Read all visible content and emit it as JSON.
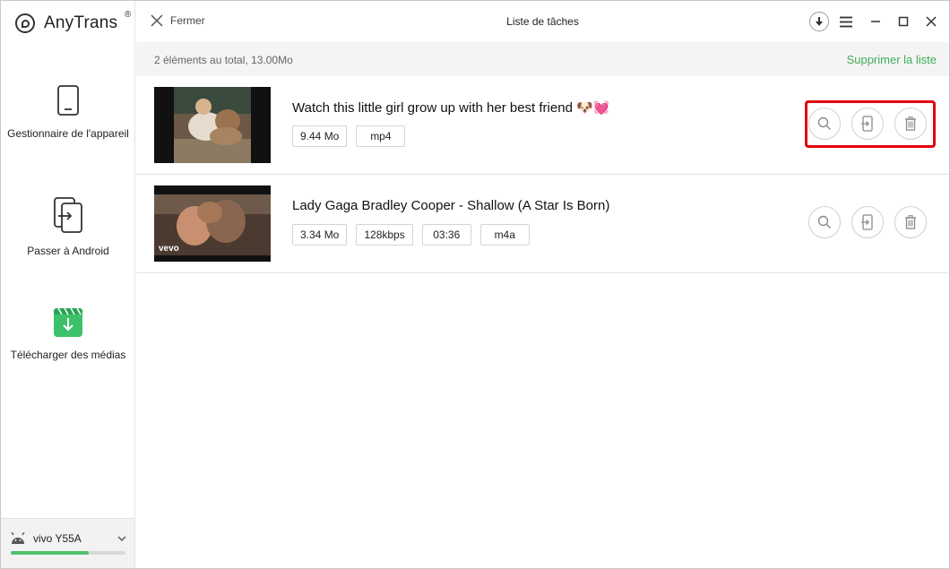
{
  "app": {
    "name": "AnyTrans",
    "registered": "®"
  },
  "sidebar": {
    "items": [
      {
        "label": "Gestionnaire de l'appareil",
        "icon": "phone-icon"
      },
      {
        "label": "Passer à Android",
        "icon": "transfer-phone-icon"
      },
      {
        "label": "Télécharger des médias",
        "icon": "media-download-icon"
      }
    ],
    "device": {
      "name": "vivo Y55A",
      "icon": "android-icon",
      "storage_fraction": 0.68
    }
  },
  "topbar": {
    "close_label": "Fermer",
    "title": "Liste de tâches"
  },
  "summary": {
    "text": "2 éléments au total, 13.00Mo",
    "clear_label": "Supprimer la liste"
  },
  "tasks": [
    {
      "title": "Watch this little girl grow up with her best friend 🐶💓",
      "tags": [
        "9.44 Mo",
        "mp4"
      ]
    },
    {
      "title": "Lady Gaga Bradley Cooper - Shallow (A Star Is Born)",
      "tags": [
        "3.34 Mo",
        "128kbps",
        "03:36",
        "m4a"
      ],
      "thumb_watermark": "vevo"
    }
  ],
  "colors": {
    "accent_green": "#3fae5a",
    "highlight_red": "#e3000f"
  }
}
